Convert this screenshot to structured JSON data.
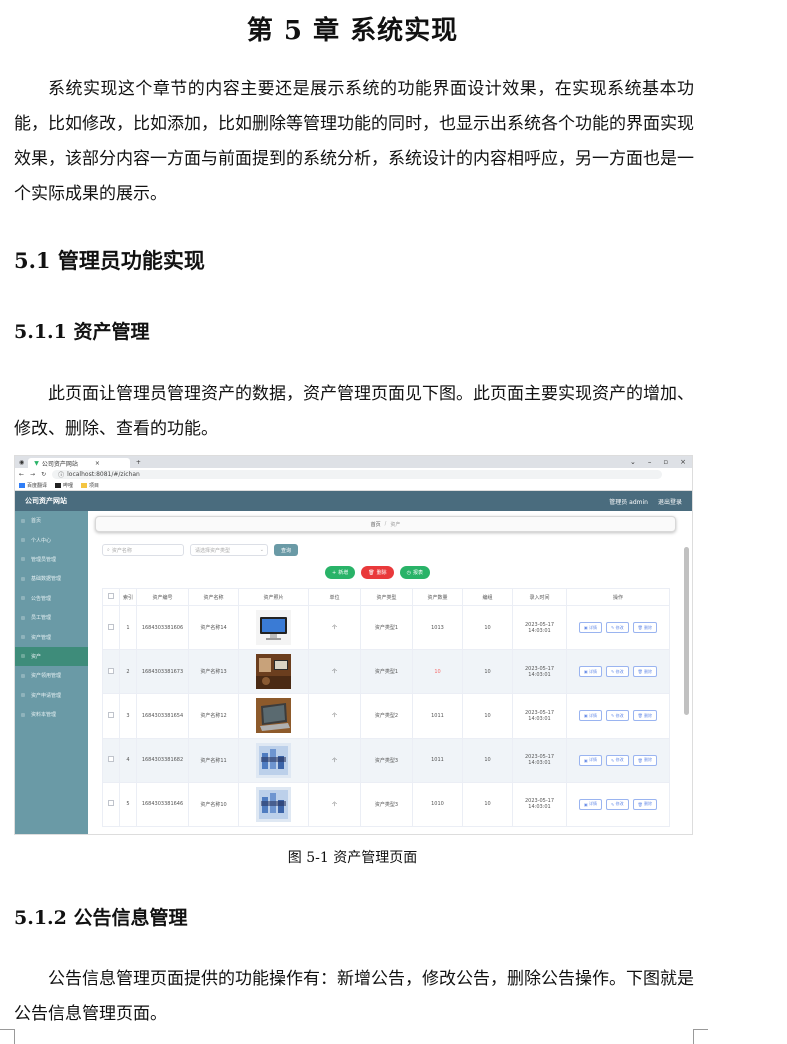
{
  "chapter_title": "第 5 章  系统实现",
  "intro_paragraph": "系统实现这个章节的内容主要还是展示系统的功能界面设计效果，在实现系统基本功能，比如修改，比如添加，比如删除等管理功能的同时，也显示出系统各个功能的界面实现效果，该部分内容一方面与前面提到的系统分析，系统设计的内容相呼应，另一方面也是一个实际成果的展示。",
  "section_5_1": "5.1 管理员功能实现",
  "section_5_1_1": "5.1.1  资产管理",
  "para_5_1_1": "此页面让管理员管理资产的数据，资产管理页面见下图。此页面主要实现资产的增加、修改、删除、查看的功能。",
  "figure_caption": "图 5-1 资产管理页面",
  "section_5_1_2": "5.1.2  公告信息管理",
  "para_5_1_2": "公告信息管理页面提供的功能操作有：新增公告，修改公告，删除公告操作。下图就是公告信息管理页面。",
  "screenshot": {
    "tab_title": "公司资产网站",
    "url": "localhost:8081/#/zichan",
    "bookmarks": [
      "百度翻译",
      "哔哩",
      "项目"
    ],
    "app_title": "公司资产网站",
    "user_label": "管理员 admin",
    "logout": "退出登录",
    "sidebar": [
      "首页",
      "个人中心",
      "管理员管理",
      "基础数据管理",
      "公告管理",
      "员工管理",
      "资产管理",
      "资产",
      "资产领用管理",
      "资产申请管理",
      "资料本管理"
    ],
    "sidebar_active": 7,
    "breadcrumb_home": "首页",
    "breadcrumb_sep": "/",
    "breadcrumb_current": "资产",
    "search_placeholder": "资产名称",
    "select_placeholder": "请选择资产类型",
    "search_button": "查询",
    "btn_add": "新增",
    "btn_delete": "删除",
    "btn_report": "报表",
    "btn_colors": {
      "add": "#29b368",
      "delete": "#e9393b",
      "report": "#29b368"
    },
    "columns": [
      "",
      "索引",
      "资产编号",
      "资产名称",
      "资产照片",
      "单位",
      "资产类型",
      "资产数量",
      "编组",
      "录入时间",
      "操作"
    ],
    "rows": [
      {
        "idx": "1",
        "code": "1684303381606",
        "name": "资产名称14",
        "unit": "个",
        "type": "资产类型1",
        "qty": "1013",
        "group": "10",
        "time": "2023-05-17 14:03:01",
        "pic": "monitor",
        "qty_red": false
      },
      {
        "idx": "2",
        "code": "1684303381673",
        "name": "资产名称13",
        "unit": "个",
        "type": "资产类型1",
        "qty": "10",
        "group": "10",
        "time": "2023-05-17 14:03:01",
        "pic": "room",
        "qty_red": true
      },
      {
        "idx": "3",
        "code": "1684303381654",
        "name": "资产名称12",
        "unit": "个",
        "type": "资产类型2",
        "qty": "1011",
        "group": "10",
        "time": "2023-05-17 14:03:01",
        "pic": "laptop",
        "qty_red": false
      },
      {
        "idx": "4",
        "code": "1684303381682",
        "name": "资产名称11",
        "unit": "个",
        "type": "资产类型3",
        "qty": "1011",
        "group": "10",
        "time": "2023-05-17 14:03:01",
        "pic": "chart",
        "qty_red": false
      },
      {
        "idx": "5",
        "code": "1684303381646",
        "name": "资产名称10",
        "unit": "个",
        "type": "资产类型3",
        "qty": "1010",
        "group": "10",
        "time": "2023-05-17 14:03:01",
        "pic": "chart",
        "qty_red": false
      }
    ],
    "op_detail": "详情",
    "op_edit": "修改",
    "op_delete": "删除"
  }
}
